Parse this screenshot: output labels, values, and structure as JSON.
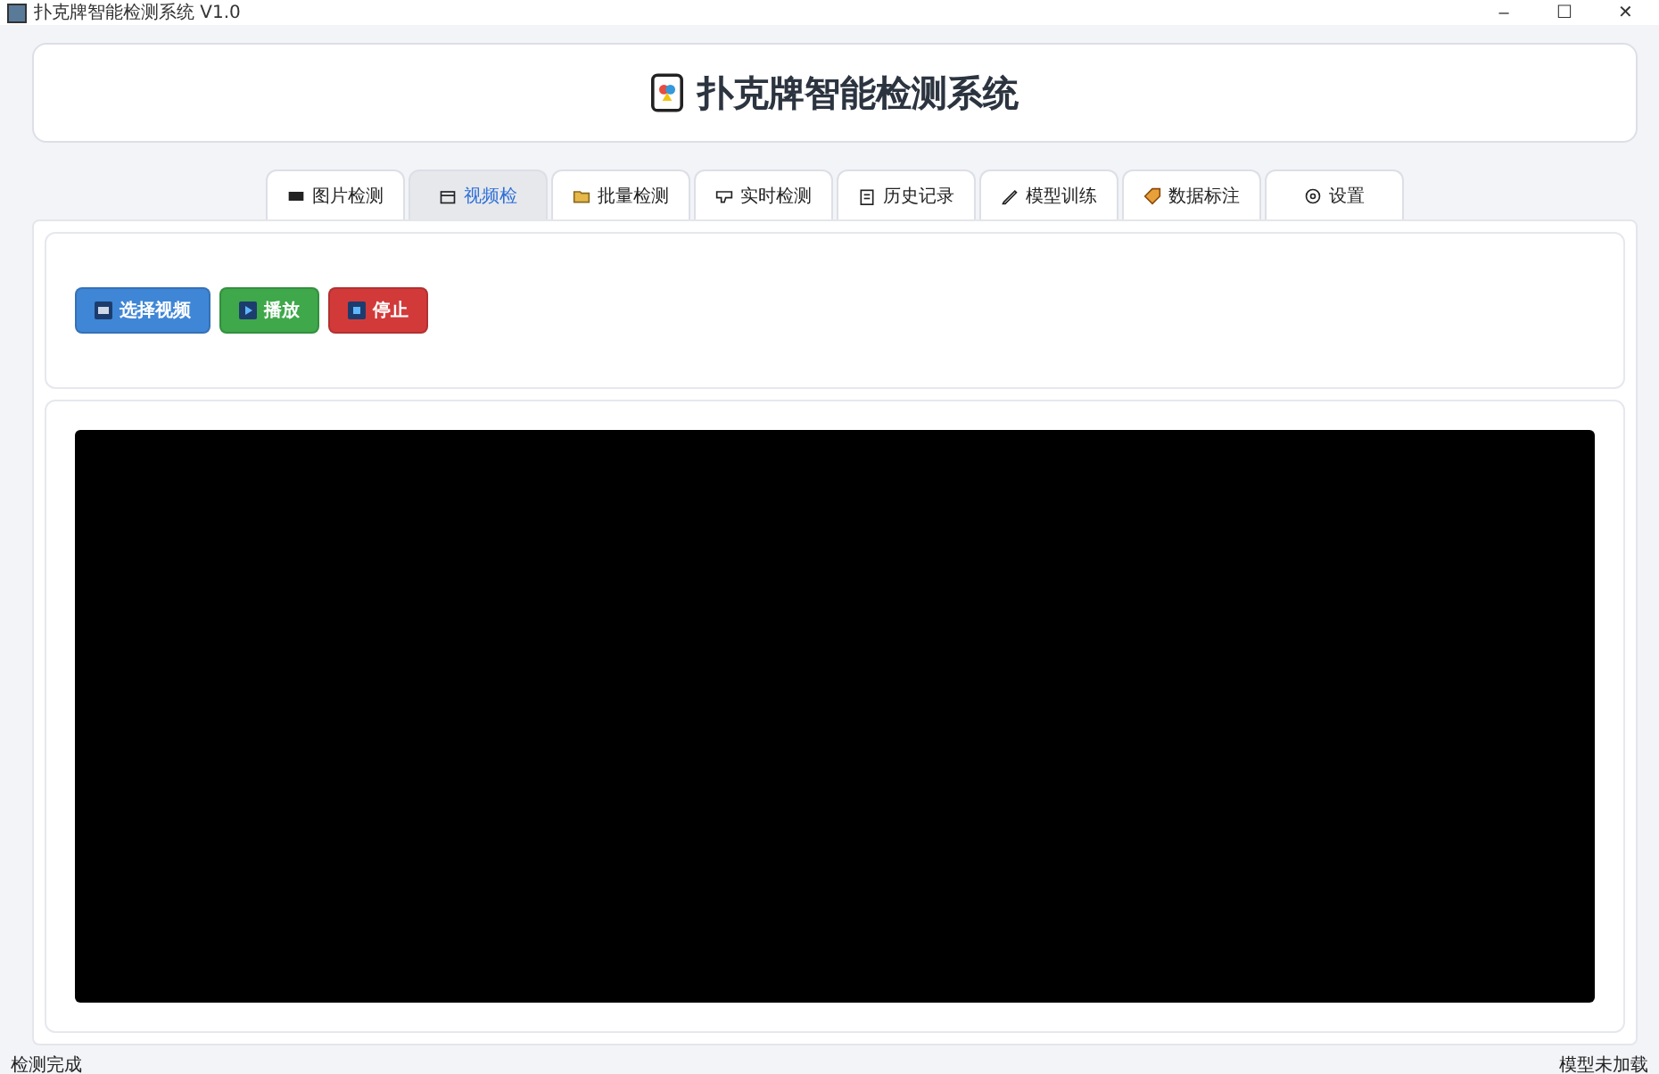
{
  "window": {
    "title": "扑克牌智能检测系统 V1.0",
    "controls": [
      "–",
      "☐",
      "✕"
    ]
  },
  "header": {
    "title": "扑克牌智能检测系统"
  },
  "tabs": [
    {
      "label": "图片检测",
      "selected": false
    },
    {
      "label": "视频检",
      "selected": true
    },
    {
      "label": "批量检测",
      "selected": false
    },
    {
      "label": "实时检测",
      "selected": false
    },
    {
      "label": "历史记录",
      "selected": false
    },
    {
      "label": "模型训练",
      "selected": false
    },
    {
      "label": "数据标注",
      "selected": false
    },
    {
      "label": "设置",
      "selected": false
    }
  ],
  "buttons": [
    {
      "label": "选择视频",
      "kind": "select"
    },
    {
      "label": "播放",
      "kind": "play"
    },
    {
      "label": "停止",
      "kind": "stop"
    }
  ],
  "status_bar": {
    "left": "检测完成",
    "right": "模型未加载"
  }
}
